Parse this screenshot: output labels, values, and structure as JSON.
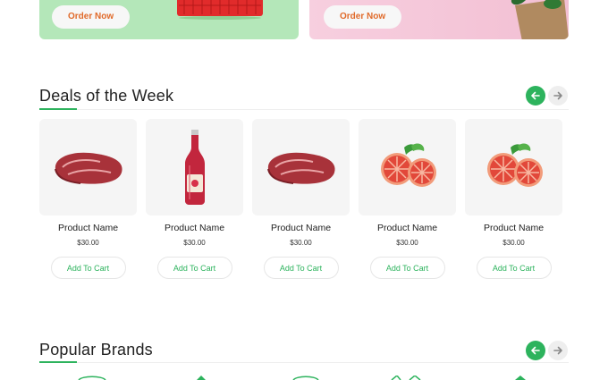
{
  "banners": [
    {
      "button": "Order Now"
    },
    {
      "button": "Order Now"
    }
  ],
  "deals": {
    "title": "Deals of the Week",
    "products": [
      {
        "name": "Product Name",
        "price": "$30.00",
        "cta": "Add To Cart",
        "image": "beef-steak"
      },
      {
        "name": "Product Name",
        "price": "$30.00",
        "cta": "Add To Cart",
        "image": "juice-bottle"
      },
      {
        "name": "Product Name",
        "price": "$30.00",
        "cta": "Add To Cart",
        "image": "beef-steak"
      },
      {
        "name": "Product Name",
        "price": "$30.00",
        "cta": "Add To Cart",
        "image": "blood-orange"
      },
      {
        "name": "Product Name",
        "price": "$30.00",
        "cta": "Add To Cart",
        "image": "blood-orange"
      }
    ]
  },
  "brands": {
    "title": "Popular Brands"
  },
  "colors": {
    "accent": "#2db35d",
    "order_text": "#e06a2a"
  },
  "icons": {
    "prev": "arrow-left-icon",
    "next": "arrow-right-icon"
  }
}
